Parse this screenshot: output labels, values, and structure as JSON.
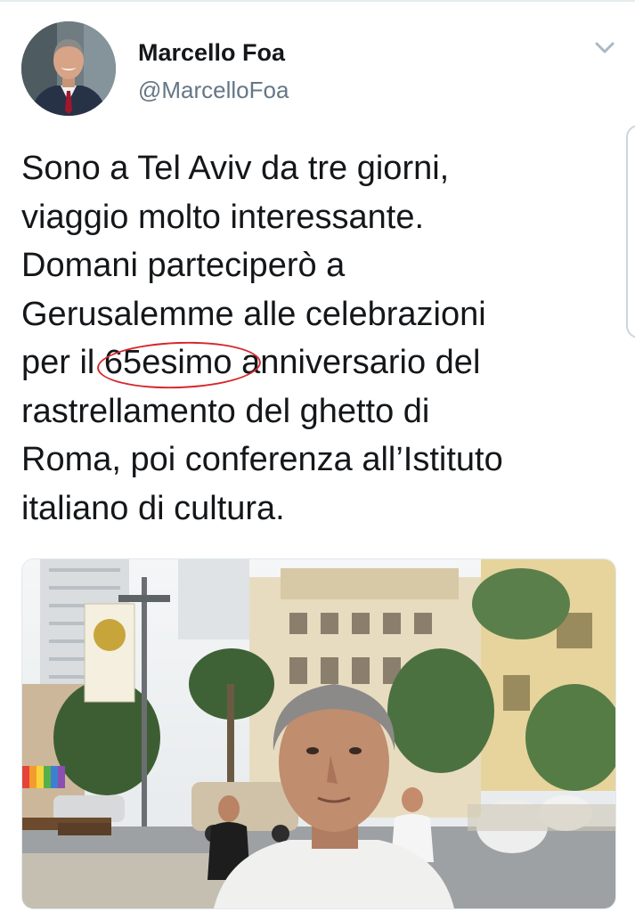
{
  "tweet": {
    "author": {
      "display_name": "Marcello Foa",
      "handle": "@MarcelloFoa"
    },
    "text_lines": [
      "Sono a Tel Aviv da tre giorni,",
      "viaggio molto interessante.",
      "Domani parteciperò a",
      "Gerusalemme alle celebrazioni"
    ],
    "line5": {
      "before": "per il ",
      "circled": "65esimo",
      "after": " anniversario del"
    },
    "text_lines_end": [
      "rastrellamento del ghetto di",
      "Roma, poi conferenza all’Istituto",
      "italiano di cultura."
    ],
    "annotation_color": "#d7262b",
    "icons": {
      "menu": "chevron-down-icon"
    }
  },
  "colors": {
    "text": "#14171a",
    "secondary": "#657786",
    "divider": "#e6ecf0"
  }
}
